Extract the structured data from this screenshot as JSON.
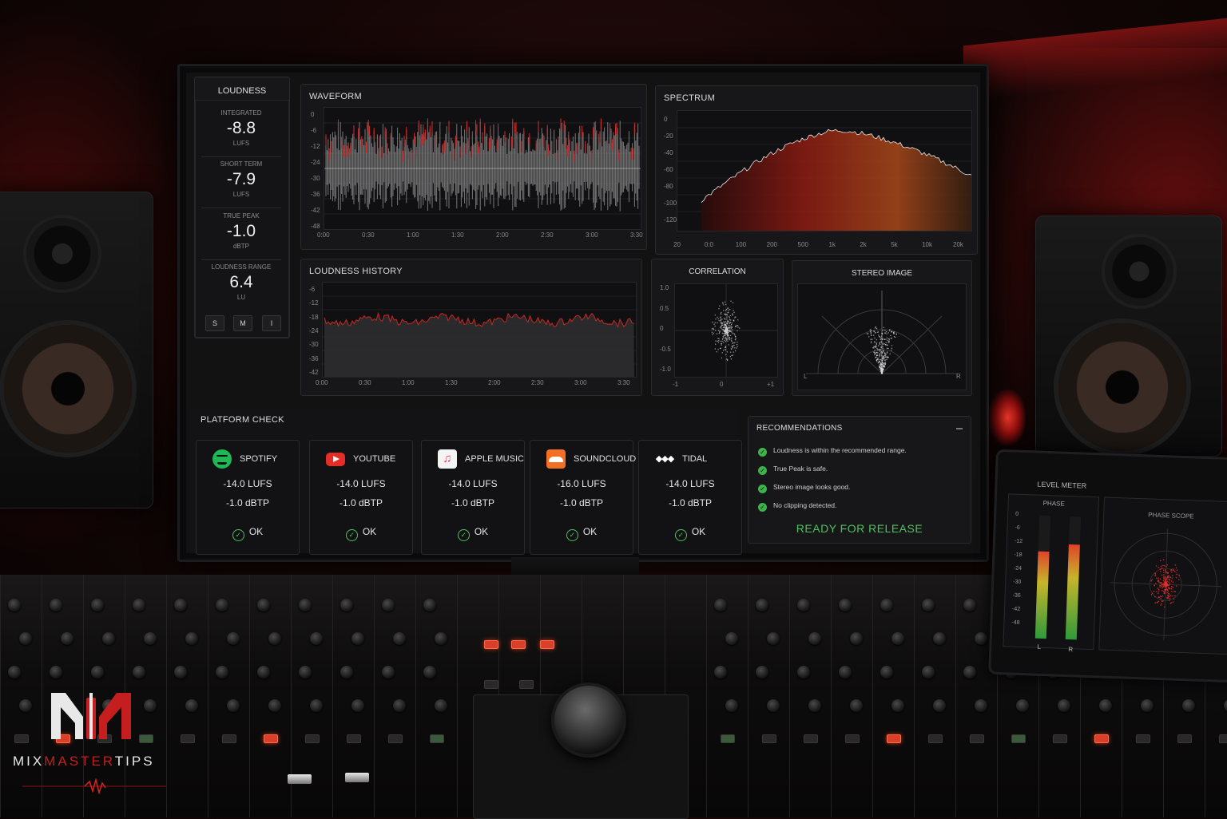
{
  "loudness": {
    "title": "LOUDNESS",
    "integrated": {
      "label": "INTEGRATED",
      "value": "-8.8",
      "unit": "LUFS"
    },
    "short_term": {
      "label": "SHORT TERM",
      "value": "-7.9",
      "unit": "LUFS"
    },
    "true_peak": {
      "label": "TRUE PEAK",
      "value": "-1.0",
      "unit": "dBTP"
    },
    "range": {
      "label": "LOUDNESS RANGE",
      "value": "6.4",
      "unit": "LU"
    },
    "modes": [
      "S",
      "M",
      "I"
    ]
  },
  "waveform": {
    "title": "WAVEFORM",
    "y_ticks": [
      "0",
      "-6",
      "-12",
      "-24",
      "-30",
      "-36",
      "-42",
      "-48"
    ],
    "x_ticks": [
      "0:00",
      "0:30",
      "1:00",
      "1:30",
      "2:00",
      "2:30",
      "3:00",
      "3:30"
    ]
  },
  "spectrum": {
    "title": "SPECTRUM",
    "y_ticks": [
      "0",
      "-20",
      "-40",
      "-60",
      "-80",
      "-100",
      "-120"
    ],
    "x_ticks": [
      "20",
      "0:0",
      "100",
      "200",
      "500",
      "1k",
      "2k",
      "5k",
      "10k",
      "20k"
    ]
  },
  "loudness_history": {
    "title": "LOUDNESS HISTORY",
    "y_ticks": [
      "-6",
      "-12",
      "-18",
      "-24",
      "-30",
      "-36",
      "-42"
    ],
    "x_ticks": [
      "0:00",
      "0:30",
      "1:00",
      "1:30",
      "2:00",
      "2:30",
      "3:00",
      "3:30"
    ]
  },
  "correlation": {
    "title": "CORRELATION",
    "y_ticks": [
      "1.0",
      "0.5",
      "0",
      "-0.5",
      "-1.0"
    ],
    "x_ticks": [
      "-1",
      "0",
      "+1"
    ]
  },
  "stereo_image": {
    "title": "STEREO IMAGE",
    "left": "L",
    "right": "R"
  },
  "platform_check": {
    "title": "PLATFORM CHECK",
    "platforms": [
      {
        "name": "SPOTIFY",
        "lufs": "-14.0 LUFS",
        "dbtp": "-1.0 dBTP",
        "status": "OK",
        "icon": "spotify-icon",
        "color": "#1db954"
      },
      {
        "name": "YOUTUBE",
        "lufs": "-14.0 LUFS",
        "dbtp": "-1.0 dBTP",
        "status": "OK",
        "icon": "youtube-icon",
        "color": "#e52d27"
      },
      {
        "name": "APPLE MUSIC",
        "lufs": "-14.0 LUFS",
        "dbtp": "-1.0 dBTP",
        "status": "OK",
        "icon": "apple-music-icon",
        "color": "#fa3e5f"
      },
      {
        "name": "SOUNDCLOUD",
        "lufs": "-16.0 LUFS",
        "dbtp": "-1.0 dBTP",
        "status": "OK",
        "icon": "soundcloud-icon",
        "color": "#f26f23"
      },
      {
        "name": "TIDAL",
        "lufs": "-14.0 LUFS",
        "dbtp": "-1.0 dBTP",
        "status": "OK",
        "icon": "tidal-icon",
        "color": "#ffffff"
      }
    ]
  },
  "recommendations": {
    "title": "RECOMMENDATIONS",
    "items": [
      "Loudness is within the recommended range.",
      "True Peak is safe.",
      "Stereo image looks good.",
      "No clipping detected."
    ],
    "verdict": "READY FOR RELEASE",
    "verdict_color": "#4cc35a"
  },
  "tablet": {
    "level_title": "LEVEL METER",
    "phase_label": "PHASE",
    "scope_title": "PHASE SCOPE",
    "db_ticks": [
      "0",
      "-6",
      "-12",
      "-18",
      "-24",
      "-30",
      "-36",
      "-42",
      "-48"
    ],
    "channels": [
      "L",
      "R"
    ],
    "level_l": 0.72,
    "level_r": 0.78
  },
  "brand": {
    "logo_text_a": "MIX",
    "logo_text_b": "MASTER",
    "logo_text_c": "TIPS",
    "accent": "#c41e1e"
  }
}
